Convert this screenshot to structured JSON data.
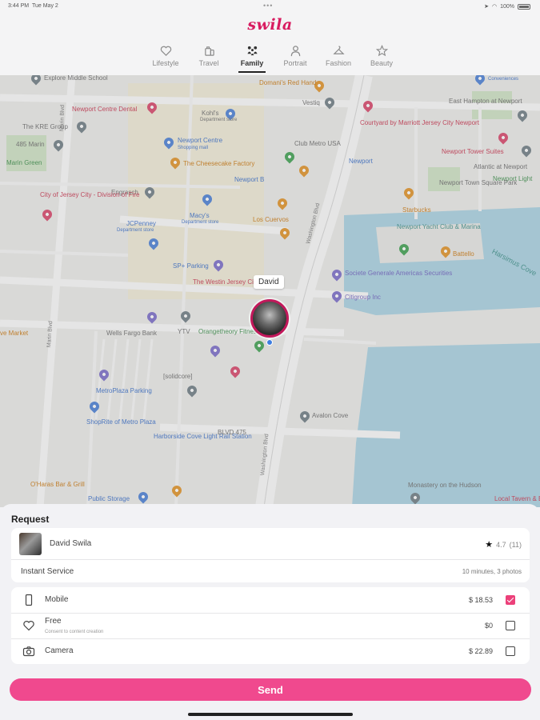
{
  "status": {
    "time": "3:44 PM",
    "date": "Tue May 2",
    "battery": "100%"
  },
  "app": {
    "logo": "swila"
  },
  "tabs": [
    {
      "label": "Lifestyle",
      "icon": "heart-icon"
    },
    {
      "label": "Travel",
      "icon": "luggage-icon"
    },
    {
      "label": "Family",
      "icon": "family-icon",
      "active": true
    },
    {
      "label": "Portrait",
      "icon": "person-icon"
    },
    {
      "label": "Fashion",
      "icon": "hanger-icon"
    },
    {
      "label": "Beauty",
      "icon": "star-icon"
    }
  ],
  "map": {
    "marker_name": "David",
    "pois": [
      "Explore Middle School",
      "Newport Centre Dental",
      "Kohl's",
      "Department store",
      "Domani's Red Hand",
      "Vestiq",
      "Courtyard by Marriott Jersey City Newport",
      "East Hampton at Newport",
      "The KRE Group",
      "Newport Centre",
      "Shopping mall",
      "Club Metro USA",
      "485 Marin",
      "Marin Green",
      "The Cheesecake Factory",
      "Newport",
      "Newport Tower Suites",
      "Atlantic at Newport",
      "Newport Light",
      "Newport B",
      "Engrasch",
      "City of Jersey City - Division of Fire",
      "Newport Town Square Park",
      "Starbucks",
      "Macy's",
      "Department store",
      "Los Cuervos",
      "JCPenney",
      "Department store",
      "Newport Yacht Club & Marina",
      "Battello",
      "SP+ Parking",
      "The Westin Jersey City Newport",
      "Societe Generale Americas Securities",
      "Citigroup Inc",
      "Wells Fargo Bank",
      "YTV",
      "Orangetheory Fitness",
      "[solidcore]",
      "MetroPlaza Parking",
      "ShopRite of Metro Plaza",
      "Avalon Cove",
      "Harborside Cove Light Rail Station",
      "BLVD 475",
      "O'Haras Bar & Grill",
      "Public Storage",
      "Monastery on the Hudson",
      "Local Tavern & Bar",
      "Harsimus Cove",
      "Conveniences",
      "ve Market"
    ],
    "roads": [
      "Marin Blvd",
      "Washington Blvd",
      "Washington Blvd",
      "Marin Blvd"
    ]
  },
  "request": {
    "title": "Request",
    "provider_name": "David Swila",
    "rating": "4.7",
    "rating_count": "(11)",
    "service_label": "Instant Service",
    "service_detail": "10 minutes, 3 photos",
    "options": [
      {
        "label": "Mobile",
        "sub": "",
        "price": "$ 18.53",
        "checked": true,
        "icon": "phone-icon"
      },
      {
        "label": "Free",
        "sub": "Consent to content creation",
        "price": "$0",
        "checked": false,
        "icon": "heart-outline-icon"
      },
      {
        "label": "Camera",
        "sub": "",
        "price": "$ 22.89",
        "checked": false,
        "icon": "camera-icon"
      }
    ],
    "send_label": "Send"
  },
  "colors": {
    "brand": "#d81b60",
    "accent": "#f0498e",
    "checkbox": "#ec407a"
  }
}
